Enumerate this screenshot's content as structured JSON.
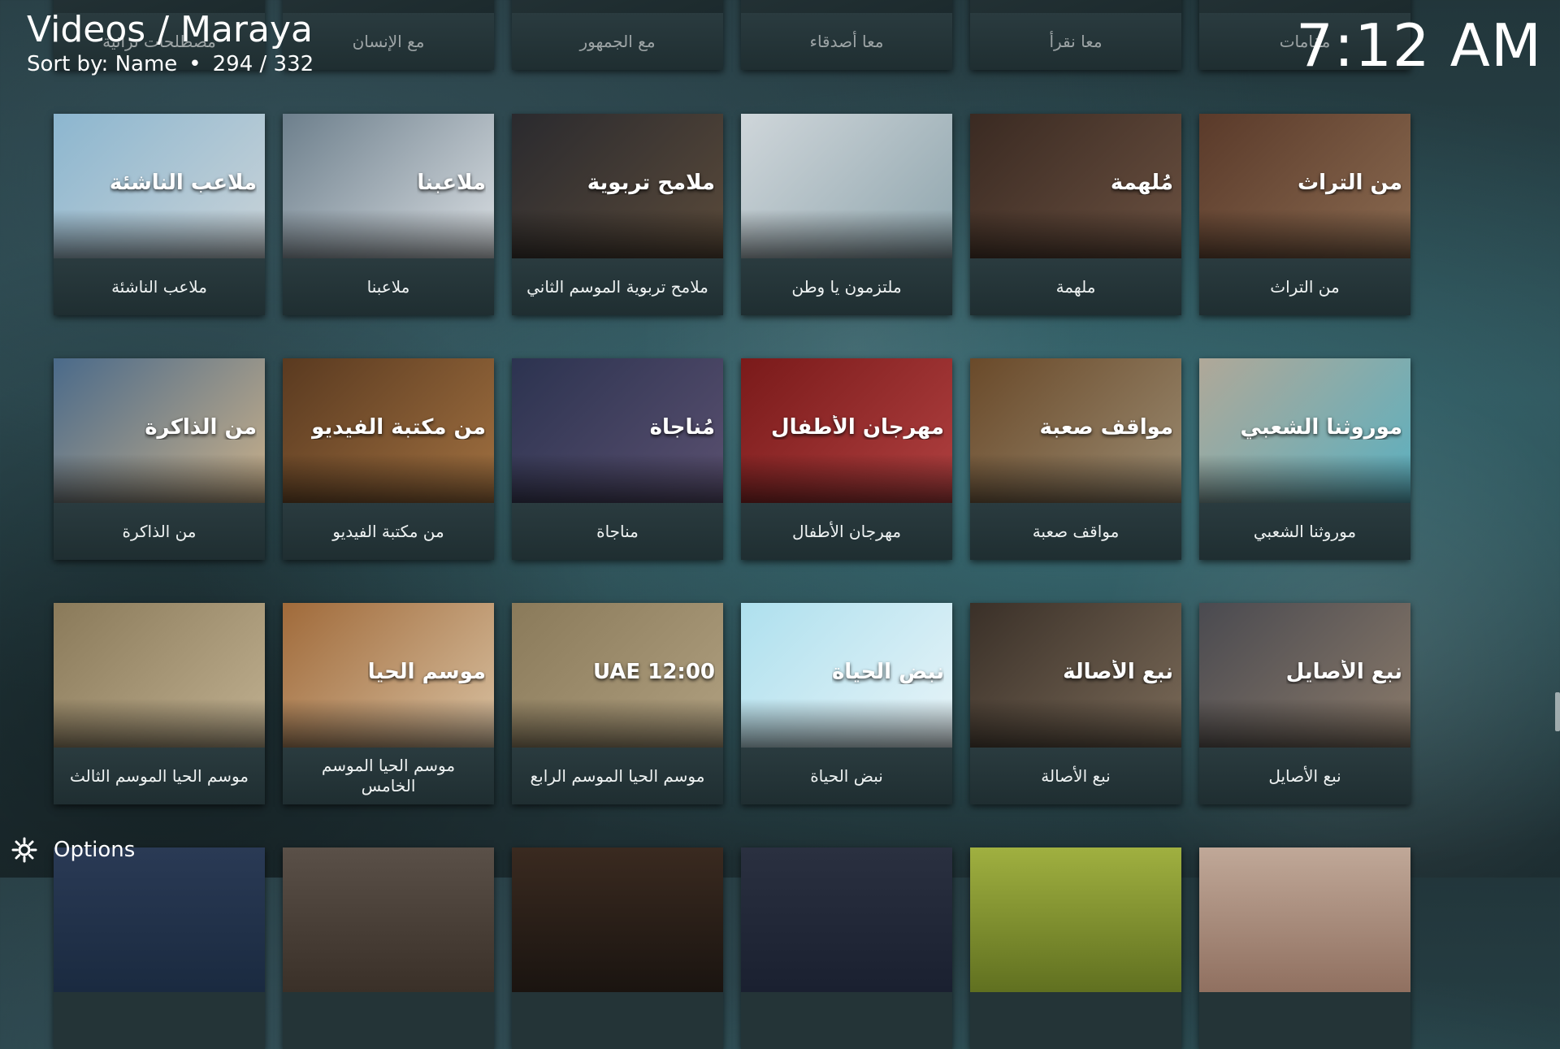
{
  "header": {
    "title": "Videos / Maraya",
    "sort_label": "Sort by: Name",
    "separator": "•",
    "counter": "294 / 332"
  },
  "clock": "7:12 AM",
  "options_label": "Options",
  "icons": {
    "options": "gear-icon"
  },
  "colors": {
    "accent": "#ffffff",
    "tile_bg": "#243437"
  },
  "top_row_partial": [
    "مصطلحات تراثية",
    "مع الإنسان",
    "مع الجمهور",
    "معا أصدقاء",
    "معا نقرأ",
    "مقامات"
  ],
  "rows": [
    [
      {
        "title": "ملاعب الناشئة",
        "overlay": "ملاعب الناشئة",
        "c1": "#8cb6cf",
        "c2": "#c9d3d8"
      },
      {
        "title": "ملاعبنا",
        "overlay": "ملاعبنا",
        "c1": "#6d7f8c",
        "c2": "#d9dee2"
      },
      {
        "title": "ملامح تربوية الموسم الثاني",
        "overlay": "ملامح تربوية",
        "c1": "#2a2a2e",
        "c2": "#5a4a3a"
      },
      {
        "title": "ملتزمون يا وطن",
        "overlay": "",
        "c1": "#cfd6da",
        "c2": "#8fa5ad"
      },
      {
        "title": "ملهمة",
        "overlay": "مُلهِمة",
        "c1": "#3a2a22",
        "c2": "#6a5040"
      },
      {
        "title": "من التراث",
        "overlay": "من التراث",
        "c1": "#5a3a2a",
        "c2": "#8a6a50"
      }
    ],
    [
      {
        "title": "من الذاكرة",
        "overlay": "من الذاكرة",
        "c1": "#4a6a8a",
        "c2": "#c9b08a"
      },
      {
        "title": "من مكتبة الفيديو",
        "overlay": "من مكتبة الفيديو",
        "c1": "#5a3a20",
        "c2": "#a07040"
      },
      {
        "title": "مناجاة",
        "overlay": "مُناجاة",
        "c1": "#2c3350",
        "c2": "#5a5070"
      },
      {
        "title": "مهرجان الأطفال",
        "overlay": "مهرجان الأطفال",
        "c1": "#7a1a1a",
        "c2": "#b04040"
      },
      {
        "title": "مواقف صعبة",
        "overlay": "مواقف صعبة",
        "c1": "#6a4a2a",
        "c2": "#9a8a70"
      },
      {
        "title": "موروثنا الشعبي",
        "overlay": "موروثنا الشعبي",
        "c1": "#b0a898",
        "c2": "#5ab0c0"
      }
    ],
    [
      {
        "title": "موسم الحيا الموسم الثالث",
        "overlay": "",
        "c1": "#8a7a5a",
        "c2": "#c0b090"
      },
      {
        "title": "موسم الحيا الموسم الخامس",
        "overlay": "موسم الحيا",
        "c1": "#a06a3a",
        "c2": "#d8c0a0"
      },
      {
        "title": "موسم الحيا الموسم الرابع",
        "overlay": "12:00 UAE",
        "c1": "#8a7a5a",
        "c2": "#b0a080"
      },
      {
        "title": "نبض الحياة",
        "overlay": "نبض الحياة",
        "c1": "#aee0ee",
        "c2": "#e8f4f8"
      },
      {
        "title": "نبع الأصالة",
        "overlay": "نبع الأصالة",
        "c1": "#3a3028",
        "c2": "#7a6a58"
      },
      {
        "title": "نبع الأصايل",
        "overlay": "نبع الأصايل",
        "c1": "#4a4a50",
        "c2": "#8a7a6a"
      }
    ]
  ],
  "bottom_row_partial": [
    {
      "c1": "#2a3a55",
      "c2": "#1a2a40"
    },
    {
      "c1": "#5a5048",
      "c2": "#3a3028"
    },
    {
      "c1": "#3a2a20",
      "c2": "#1a1410"
    },
    {
      "c1": "#2a3040",
      "c2": "#1a2030"
    },
    {
      "c1": "#a0b040",
      "c2": "#607020"
    },
    {
      "c1": "#c0a898",
      "c2": "#907060"
    }
  ]
}
